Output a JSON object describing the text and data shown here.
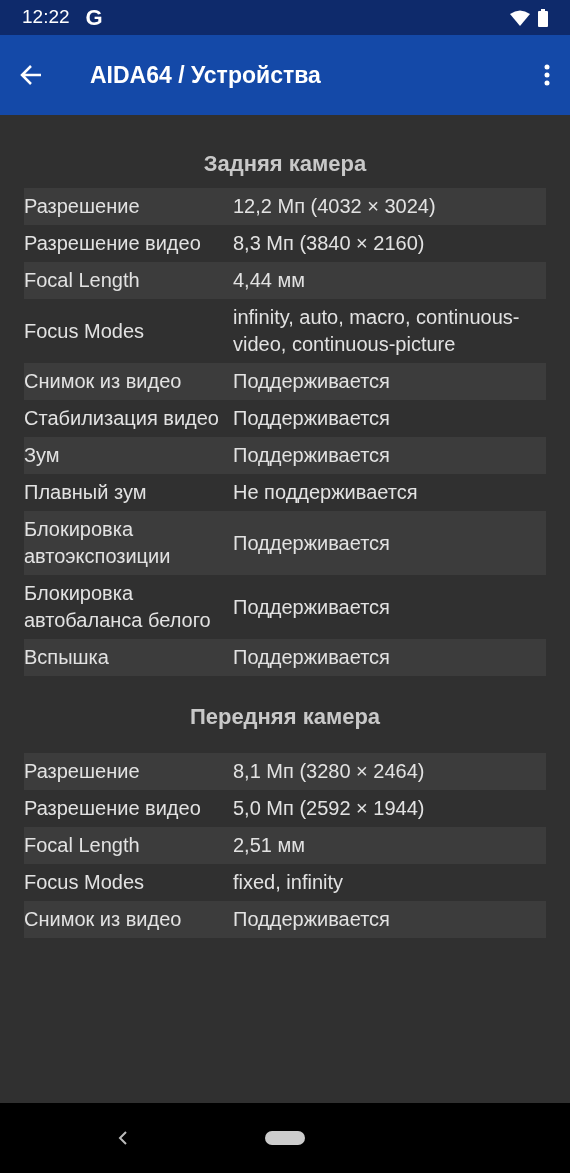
{
  "status_bar": {
    "time": "12:22",
    "notification": "G"
  },
  "app_bar": {
    "title": "AIDA64 / Устройства"
  },
  "sections": [
    {
      "title": "Задняя камера",
      "rows": [
        {
          "label": "Разрешение",
          "value": "12,2 Мп (4032 × 3024)"
        },
        {
          "label": "Разрешение видео",
          "value": "8,3 Мп (3840 × 2160)"
        },
        {
          "label": "Focal Length",
          "value": "4,44 мм"
        },
        {
          "label": "Focus Modes",
          "value": "infinity, auto, macro, continuous-video, continuous-picture"
        },
        {
          "label": "Снимок из видео",
          "value": "Поддерживается"
        },
        {
          "label": "Стабилизация видео",
          "value": "Поддерживается"
        },
        {
          "label": "Зум",
          "value": "Поддерживается"
        },
        {
          "label": "Плавный зум",
          "value": "Не поддерживается"
        },
        {
          "label": "Блокировка автоэкспозиции",
          "value": "Поддерживается"
        },
        {
          "label": "Блокировка автобаланса белого",
          "value": "Поддерживается"
        },
        {
          "label": "Вспышка",
          "value": "Поддерживается"
        }
      ]
    },
    {
      "title": "Передняя камера",
      "rows": [
        {
          "label": "Разрешение",
          "value": "8,1 Мп (3280 × 2464)"
        },
        {
          "label": "Разрешение видео",
          "value": "5,0 Мп (2592 × 1944)"
        },
        {
          "label": "Focal Length",
          "value": "2,51 мм"
        },
        {
          "label": "Focus Modes",
          "value": "fixed, infinity"
        },
        {
          "label": "Снимок из видео",
          "value": "Поддерживается"
        }
      ]
    }
  ]
}
